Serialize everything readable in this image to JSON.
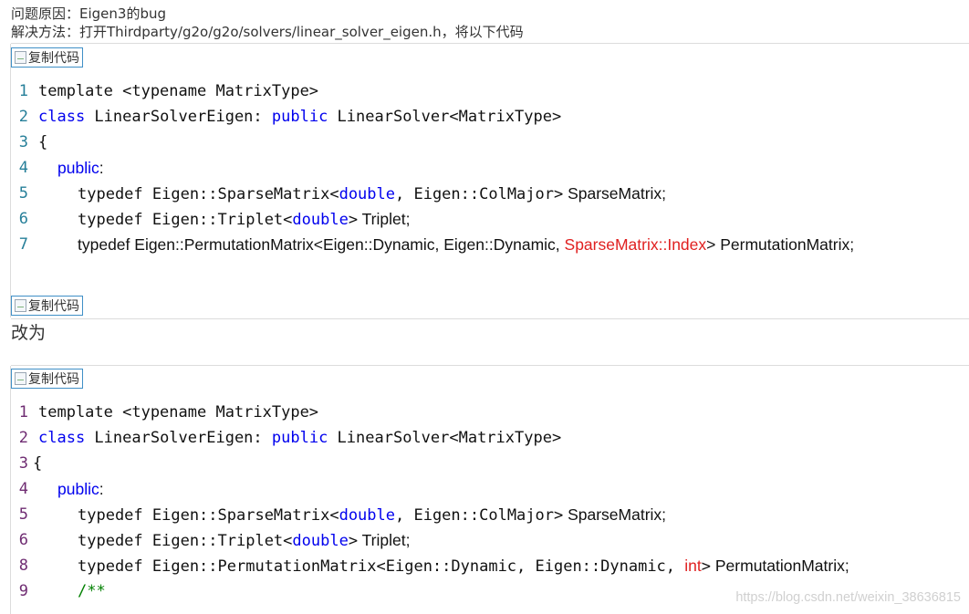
{
  "intro": {
    "cause": "问题原因：Eigen3的bug",
    "fix": "解决方法：打开Thirdparty/g2o/g2o/solvers/linear_solver_eigen.h，将以下代码"
  },
  "copy_button_label": "复制代码",
  "block1": {
    "lines": [
      {
        "n": "1",
        "parts": [
          {
            "t": "template <typename MatrixType>",
            "c": "mono"
          }
        ]
      },
      {
        "n": "2",
        "parts": [
          {
            "t": "class",
            "c": "kw mono"
          },
          {
            "t": " LinearSolverEigen: ",
            "c": "mono"
          },
          {
            "t": "public",
            "c": "kw mono"
          },
          {
            "t": " LinearSolver<MatrixType>",
            "c": "mono"
          }
        ]
      },
      {
        "n": "3",
        "parts": [
          {
            "t": "{",
            "c": "mono"
          }
        ]
      },
      {
        "n": "4",
        "parts": [
          {
            "t": "public",
            "c": "kw sans"
          },
          {
            "t": ":",
            "c": "sans"
          }
        ]
      },
      {
        "n": "5",
        "parts": [
          {
            "t": "typedef Eigen::SparseMatrix<",
            "c": "mono"
          },
          {
            "t": "double",
            "c": "kw mono"
          },
          {
            "t": ", Eigen::ColMajor>",
            "c": "mono"
          },
          {
            "t": " SparseMatrix;",
            "c": "sans"
          }
        ]
      },
      {
        "n": "6",
        "parts": [
          {
            "t": "typedef Eigen::Triplet<",
            "c": "mono"
          },
          {
            "t": "double",
            "c": "kw mono"
          },
          {
            "t": ">",
            "c": "mono"
          },
          {
            "t": " Triplet;",
            "c": "sans"
          }
        ]
      },
      {
        "n": "7",
        "parts": [
          {
            "t": "typedef Eigen::PermutationMatrix<Eigen::Dynamic, Eigen::Dynamic, ",
            "c": "sans"
          },
          {
            "t": "SparseMatrix::Index",
            "c": "red sans"
          },
          {
            "t": "> PermutationMatrix;",
            "c": "sans"
          }
        ]
      }
    ]
  },
  "change_label": "改为",
  "block2": {
    "lines": [
      {
        "n": "1",
        "parts": [
          {
            "t": "template <typename MatrixType>",
            "c": "mono"
          }
        ]
      },
      {
        "n": "2",
        "parts": [
          {
            "t": "class",
            "c": "kw mono"
          },
          {
            "t": " LinearSolverEigen: ",
            "c": "mono"
          },
          {
            "t": "public",
            "c": "kw mono"
          },
          {
            "t": " LinearSolver<MatrixType>",
            "c": "mono"
          }
        ]
      },
      {
        "n": "3",
        "parts": [
          {
            "t": "{",
            "c": "mono"
          }
        ]
      },
      {
        "n": "4",
        "parts": [
          {
            "t": "public",
            "c": "kw sans"
          },
          {
            "t": ":",
            "c": "sans"
          }
        ]
      },
      {
        "n": "5",
        "parts": [
          {
            "t": "typedef Eigen::SparseMatrix<",
            "c": "mono"
          },
          {
            "t": "double",
            "c": "kw mono"
          },
          {
            "t": ", Eigen::ColMajor>",
            "c": "mono"
          },
          {
            "t": " SparseMatrix;",
            "c": "sans"
          }
        ]
      },
      {
        "n": "6",
        "parts": [
          {
            "t": "typedef Eigen::Triplet<",
            "c": "mono"
          },
          {
            "t": "double",
            "c": "kw mono"
          },
          {
            "t": ">",
            "c": "mono"
          },
          {
            "t": " Triplet;",
            "c": "sans"
          }
        ]
      },
      {
        "n": "8",
        "parts": [
          {
            "t": "typedef Eigen::PermutationMatrix<Eigen::Dynamic, Eigen::Dynamic, ",
            "c": "mono"
          },
          {
            "t": "int",
            "c": "red sans"
          },
          {
            "t": ">",
            "c": "mono"
          },
          {
            "t": " PermutationMatrix;",
            "c": "sans"
          }
        ]
      },
      {
        "n": "9",
        "parts": [
          {
            "t": "/**",
            "c": "cmt mono"
          }
        ]
      }
    ]
  },
  "watermark": "https://blog.csdn.net/weixin_38636815"
}
